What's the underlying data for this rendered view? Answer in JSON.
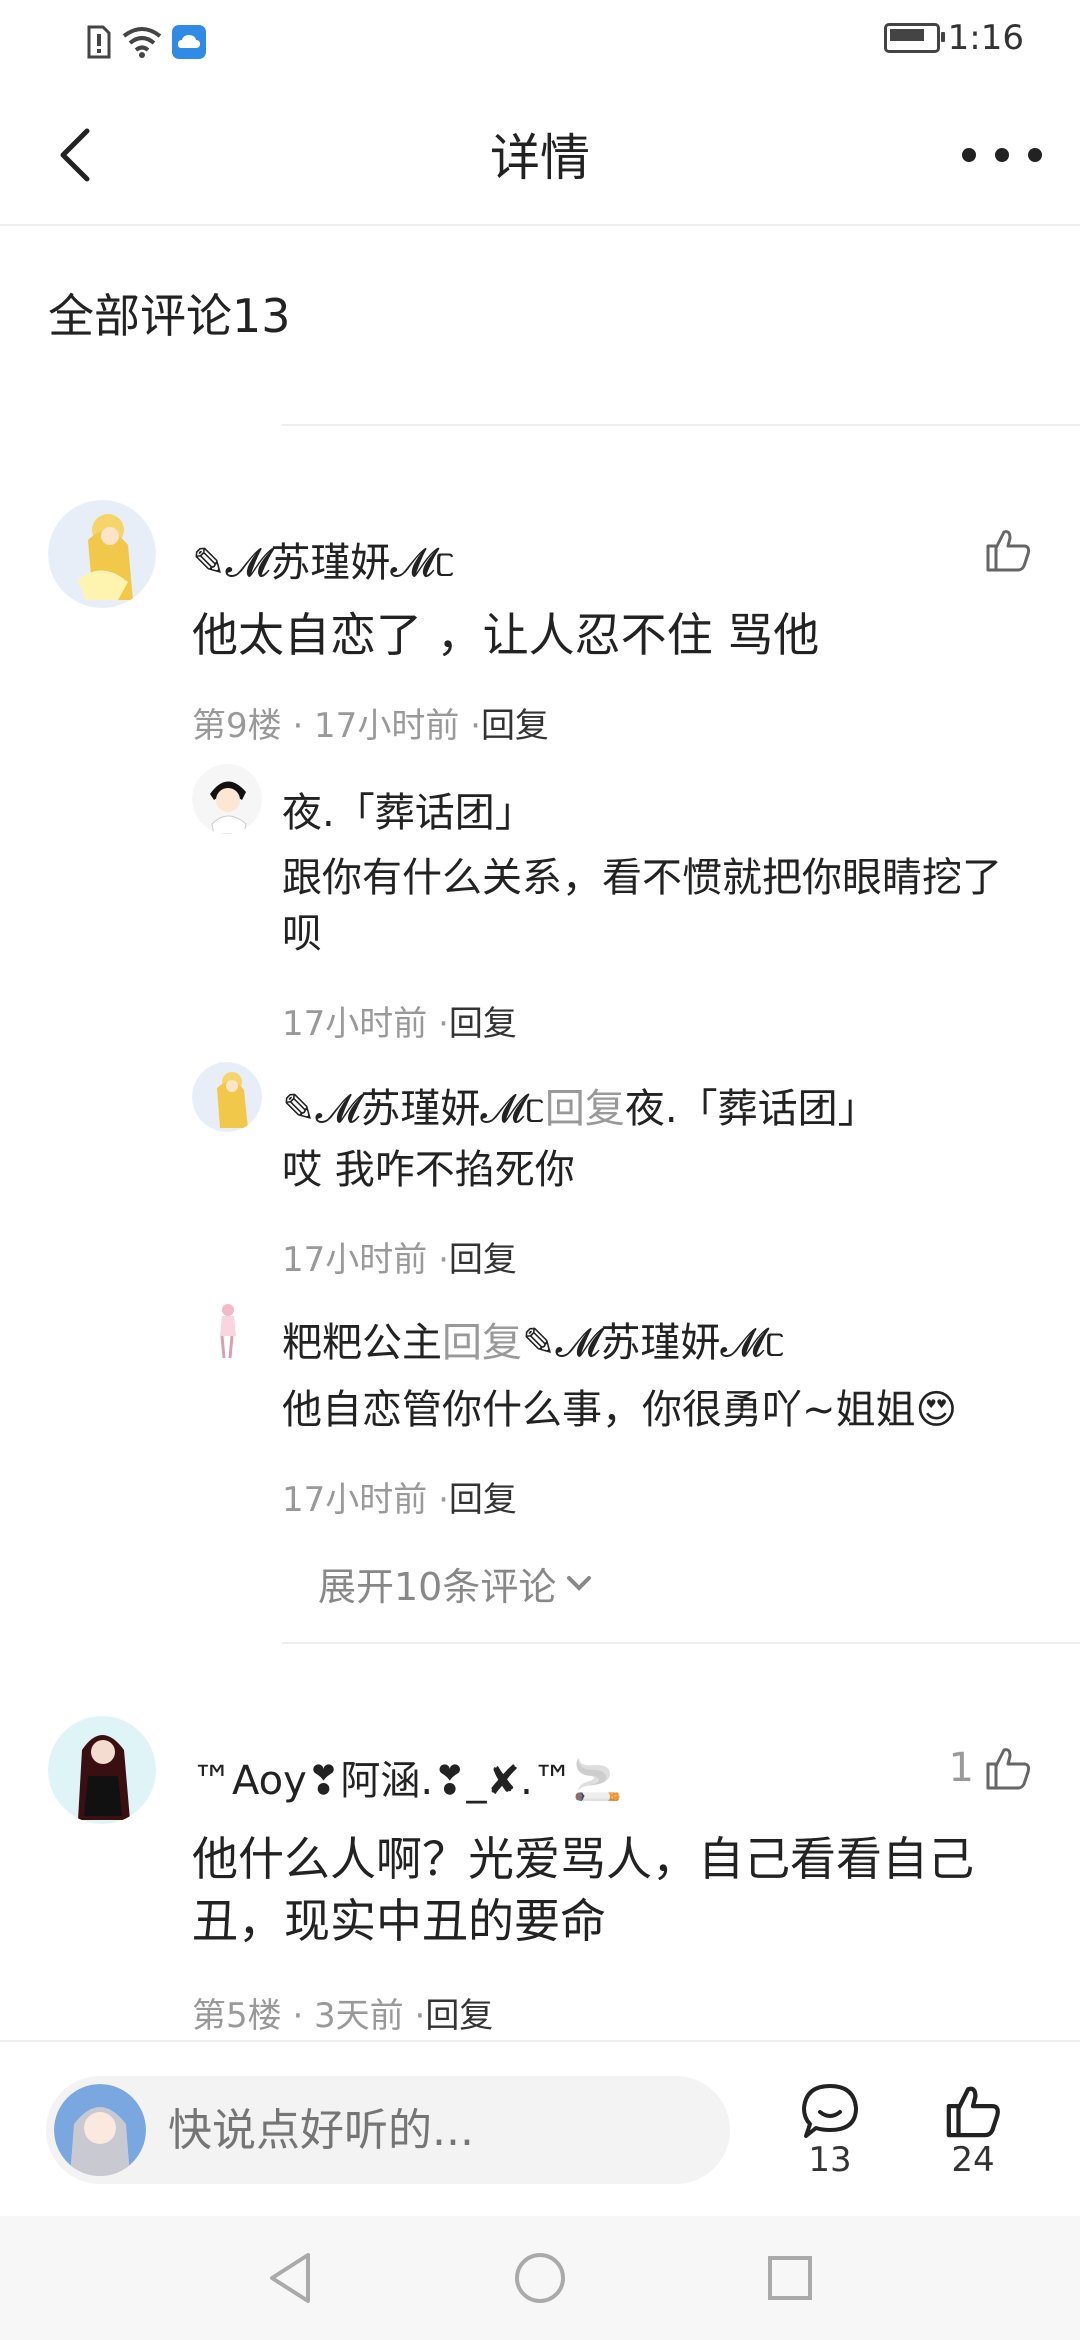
{
  "status_bar": {
    "time": "1:16"
  },
  "header": {
    "title": "详情"
  },
  "comments_section": {
    "title": "全部评论13"
  },
  "comments": [
    {
      "username": "✎𝓜苏瑾妍𝓜ᥴ",
      "text": "他太自恋了 ，让人忍不住 骂他",
      "meta": "第9楼 · 17小时前 ·",
      "reply_label": "回复",
      "likes": "",
      "replies": [
        {
          "username": "夜.「葬话团」",
          "text": "跟你有什么关系，看不惯就把你眼睛挖了呗",
          "meta": "17小时前 ·",
          "reply_label": "回复"
        },
        {
          "username": "✎𝓜苏瑾妍𝓜ᥴ",
          "reply_to_word": "回复",
          "reply_to": "夜.「葬话团」",
          "text": "哎 我咋不掐死你",
          "meta": "17小时前 ·",
          "reply_label": "回复"
        },
        {
          "username": "粑粑公主",
          "reply_to_word": "回复",
          "reply_to": "✎𝓜苏瑾妍𝓜ᥴ",
          "text": "他自恋管你什么事，你很勇吖~姐姐😍",
          "meta": "17小时前 ·",
          "reply_label": "回复"
        }
      ],
      "expand_label": "展开10条评论"
    },
    {
      "username": "™Aoy❣阿涵.❣_✘.™🚬",
      "text": "他什么人啊？光爱骂人，自己看看自己丑，现实中丑的要命",
      "meta": "第5楼 · 3天前 ·",
      "reply_label": "回复",
      "likes": "1"
    }
  ],
  "bottom_bar": {
    "input_placeholder": "快说点好听的...",
    "comment_count": "13",
    "like_count": "24"
  },
  "colors": {
    "accent_like": "#333333",
    "muted": "#999999"
  }
}
